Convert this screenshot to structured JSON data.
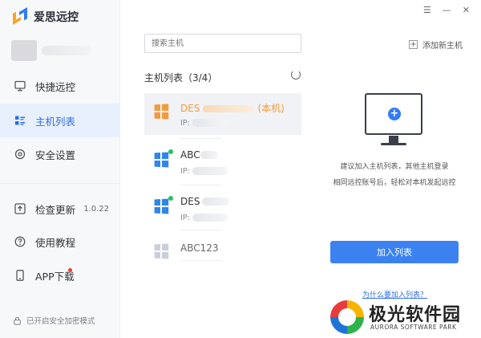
{
  "app": {
    "title": "爱思远控"
  },
  "window_controls": [
    "☰",
    "—",
    "✕"
  ],
  "sidebar": {
    "items": [
      {
        "label": "快捷远控",
        "icon": "monitor-icon"
      },
      {
        "label": "主机列表",
        "icon": "list-icon",
        "active": true
      },
      {
        "label": "安全设置",
        "icon": "shield-icon"
      },
      {
        "label": "检查更新",
        "icon": "upload-icon",
        "version": "1.0.22"
      },
      {
        "label": "使用教程",
        "icon": "help-icon"
      },
      {
        "label": "APP下载",
        "icon": "phone-icon",
        "badge": true
      }
    ],
    "secure_mode": "已开启安全加密模式"
  },
  "search": {
    "placeholder": "搜索主机"
  },
  "host_list": {
    "title": "主机列表（3/4）",
    "hosts": [
      {
        "name": "DES",
        "suffix": "(本机)",
        "ip_label": "IP:",
        "online": false,
        "selected": true,
        "color": "#f39a3c"
      },
      {
        "name": "ABC",
        "suffix": "",
        "ip_label": "IP:",
        "online": true,
        "selected": false,
        "color": "#2f86e8"
      },
      {
        "name": "DES",
        "suffix": "",
        "ip_label": "IP:",
        "online": true,
        "selected": false,
        "color": "#2f86e8"
      },
      {
        "name": "ABC123",
        "suffix": "",
        "ip_label": "",
        "online": false,
        "selected": false,
        "color": "#c9cfda"
      }
    ]
  },
  "right": {
    "add_host": "添加新主机",
    "desc_line1": "建议加入主机列表，其他主机登录",
    "desc_line2": "相同远控账号后，轻松对本机发起远控",
    "join_button": "加入列表",
    "why_link": "为什么要加入列表？"
  },
  "watermark": {
    "cn": "极光软件园",
    "en": "AURORA SOFTWARE PARK"
  }
}
